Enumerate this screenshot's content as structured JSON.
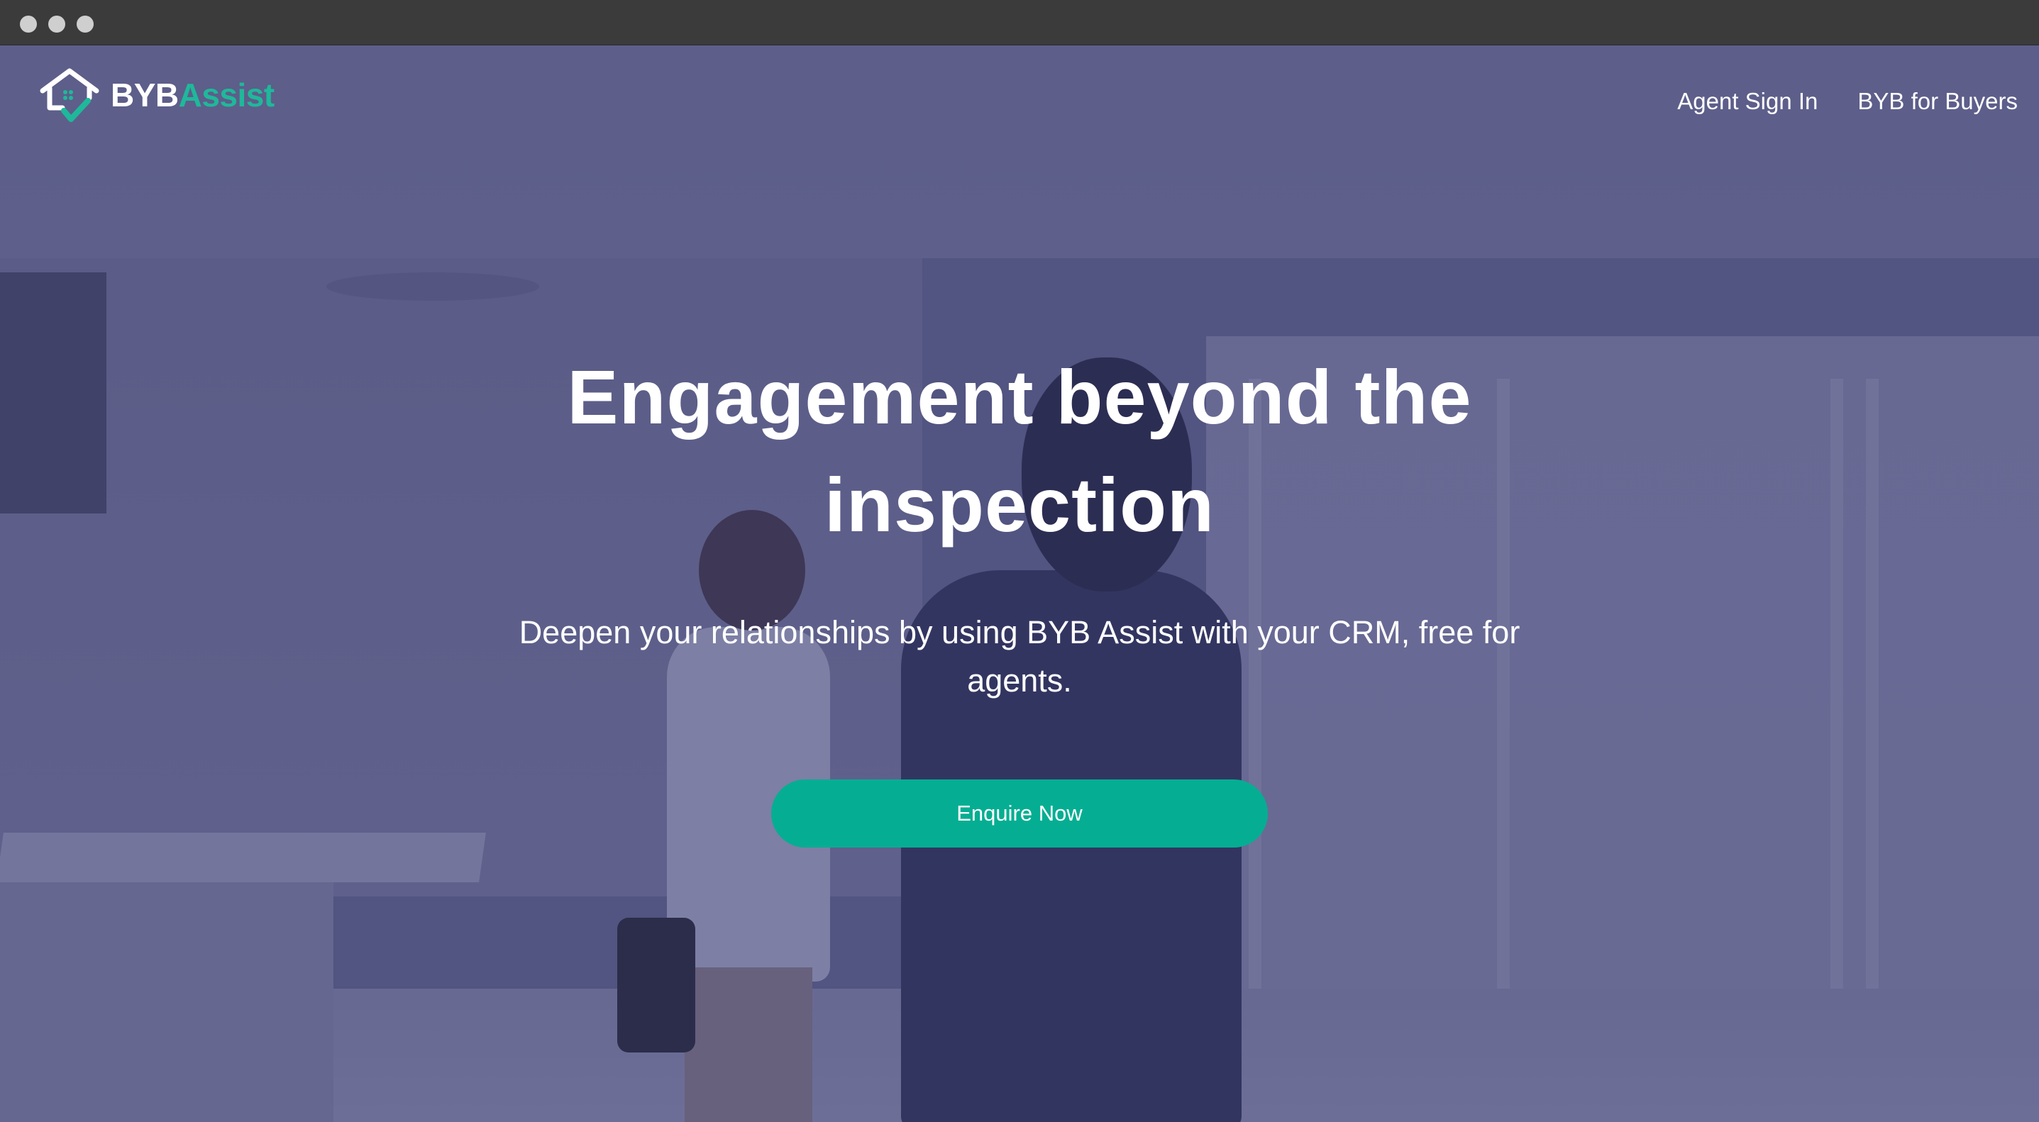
{
  "brand": {
    "name_part1": "BYB",
    "name_part2": "Assist",
    "accent_color": "#1fb89a",
    "logo_icon": "house-check-icon"
  },
  "nav": {
    "items": [
      {
        "label": "Agent Sign In"
      },
      {
        "label": "BYB for Buyers"
      }
    ]
  },
  "hero": {
    "title": "Engagement beyond the inspection",
    "subtitle": "Deepen your relationships by using BYB Assist with your CRM, free for agents.",
    "cta_label": "Enquire Now",
    "cta_color": "#05ae92"
  }
}
